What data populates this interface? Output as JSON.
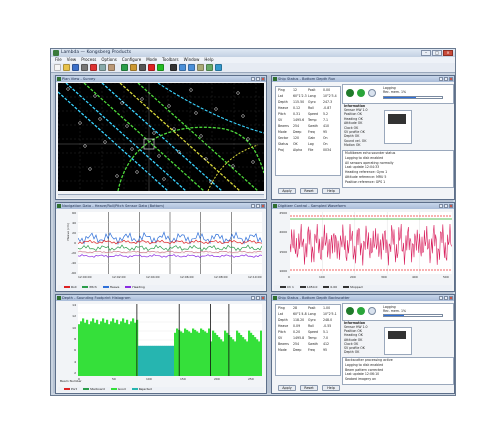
{
  "app": {
    "title": "Lambda — Kongsberg Products",
    "menu": [
      "File",
      "View",
      "Process",
      "Options",
      "Configure",
      "Mode",
      "Toolbars",
      "Window",
      "Help"
    ],
    "toolbar_icons": [
      "new-icon",
      "open-icon",
      "save-icon",
      "print-icon",
      "cut-icon",
      "copy-icon",
      "paste-icon",
      "chart-icon",
      "waveform-icon",
      "settings-icon",
      "record-icon",
      "play-icon",
      "stop-icon",
      "zoom-in-icon",
      "zoom-out-icon",
      "pan-icon",
      "grid-icon",
      "help-icon"
    ]
  },
  "windows": {
    "plan": {
      "title": "Plan View - Survey"
    },
    "status": {
      "title": "Ship Status - Bottom Depth Run",
      "rows": [
        [
          "Ping",
          "12",
          "Posit",
          "0.00"
        ],
        [
          "Lat",
          "60°1'2.3",
          "Long",
          "10°2'3.4"
        ],
        [
          "Depth",
          "115.50",
          "Gyro",
          "247.3"
        ],
        [
          "Heave",
          "0.12",
          "Roll",
          "-0.87"
        ],
        [
          "Pitch",
          "0.31",
          "Speed",
          "5.2"
        ],
        [
          "SV",
          "1495.6",
          "Temp",
          "7.1"
        ],
        [
          "Beams",
          "254",
          "Swath",
          "410"
        ],
        [
          "Mode",
          "Deep",
          "Freq",
          "95"
        ],
        [
          "Sector",
          "120",
          "Gain",
          "On"
        ],
        [
          "Status",
          "OK",
          "Log",
          "On"
        ],
        [
          "Proj",
          "Alpha",
          "File",
          "0034"
        ]
      ],
      "panel_title": "Logging",
      "panel_value": "Rec. mem. 1%",
      "info_title": "Information",
      "info_rows": [
        "Sensor HW 1.0",
        "Position OK",
        "Heading OK",
        "Attitude OK",
        "Clock OK",
        "SV profile OK",
        "Depth OK",
        "Sound vel. OK",
        "Motion OK"
      ],
      "note_lines": [
        "Multibeam echo sounder status",
        "Logging to disk enabled",
        "All sensors operating normally",
        "Last update 12:04:33",
        "Heading reference: Gyro 1",
        "Attitude reference: MRU 5",
        "Position reference: GPS 1"
      ],
      "buttons": [
        "Apply",
        "Reset",
        "Help"
      ],
      "progress": 0.55
    },
    "timeseries": {
      "title": "Navigation Data - Heave/Roll/Pitch Sensor Data (Bottom)",
      "y_ticks": [
        "60",
        "40",
        "20",
        "0",
        "-20",
        "-40",
        "-60"
      ],
      "x_ticks": [
        "12:00:00",
        "12:02:00",
        "12:04:00",
        "12:06:00",
        "12:08:00",
        "12:10:00"
      ],
      "ylabel": "Heave (cm)",
      "legend": [
        "Roll",
        "Pitch",
        "Heave",
        "Heading"
      ]
    },
    "scope": {
      "title": "Digitizer Control - Sampled Waveform",
      "y_ticks": [
        "2500",
        "2000",
        "1500",
        "1000"
      ],
      "x_ticks": [
        "0",
        "100",
        "200",
        "300",
        "400",
        "500"
      ],
      "status_items": [
        "Ch 1",
        "1450.0",
        "0.00",
        "Stopped"
      ]
    },
    "histogram": {
      "title": "Depth - Sounding Footprint Histogram",
      "y_ticks": [
        "14",
        "12",
        "10",
        "8",
        "6",
        "4",
        "2"
      ],
      "x_ticks": [
        "0",
        "50",
        "100",
        "150",
        "200",
        "250"
      ],
      "xlabel": "Beam Number",
      "legend": [
        "Port",
        "Starboard",
        "Good",
        "Rejected"
      ]
    },
    "status2": {
      "title": "Ship Status - Bottom Depth Backscatter",
      "rows": [
        [
          "Ping",
          "28",
          "Posit",
          "1.00"
        ],
        [
          "Lat",
          "60°1'4.8",
          "Long",
          "10°2'5.1"
        ],
        [
          "Depth",
          "118.20",
          "Gyro",
          "248.0"
        ],
        [
          "Heave",
          "0.09",
          "Roll",
          "-0.55"
        ],
        [
          "Pitch",
          "0.20",
          "Speed",
          "5.1"
        ],
        [
          "SV",
          "1495.8",
          "Temp",
          "7.0"
        ],
        [
          "Beams",
          "254",
          "Swath",
          "412"
        ],
        [
          "Mode",
          "Deep",
          "Freq",
          "95"
        ]
      ],
      "panel_title": "Logging",
      "panel_value": "Rec. mem. 1%",
      "info_title": "Information",
      "info_rows": [
        "Sensor HW 1.0",
        "Position OK",
        "Heading OK",
        "Attitude OK",
        "Clock OK",
        "SV profile OK",
        "Depth OK"
      ],
      "note_lines": [
        "Backscatter processing active",
        "Logging to disk enabled",
        "Beam pattern corrected",
        "Last update 12:06:10",
        "Seabed imagery on"
      ],
      "buttons": [
        "Apply",
        "Reset",
        "Help"
      ],
      "progress": 0.35
    }
  },
  "colors": {
    "accent": "#2e6fd8",
    "plan_bg": "#000000",
    "track_cyan": "#39d3ff",
    "track_green": "#4dd93a",
    "track_yellow": "#d8d83a",
    "wave": "#d81b5a",
    "bar_green": "#35e03a",
    "bar_teal": "#26b5b0"
  }
}
